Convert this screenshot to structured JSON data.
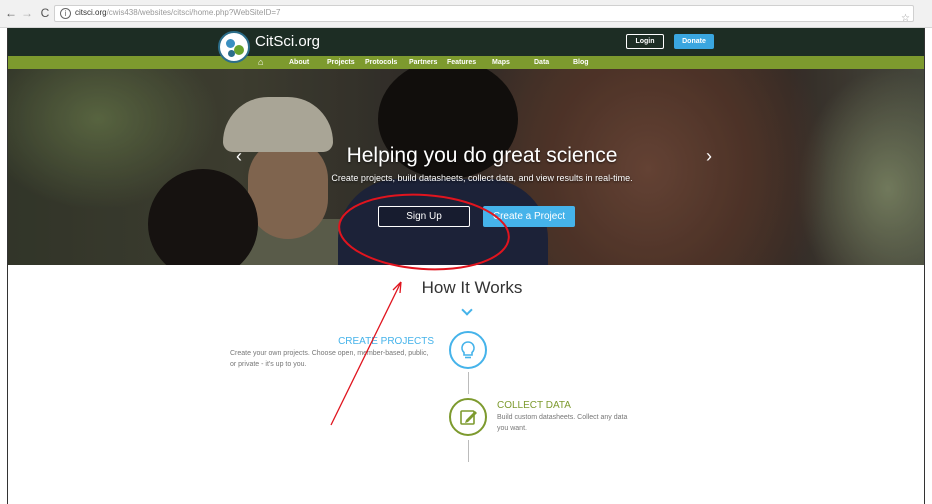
{
  "browser": {
    "back_glyph": "←",
    "forward_glyph": "→",
    "reload_glyph": "C",
    "info_glyph": "i",
    "url_host": "citsci.org",
    "url_path": "/cwis438/websites/citsci/home.php?WebSiteID=7",
    "star_glyph": "☆"
  },
  "header": {
    "logo_text": "CitSci.org",
    "login_label": "Login",
    "donate_label": "Donate"
  },
  "nav": {
    "home_glyph": "⌂",
    "items": [
      "About",
      "Projects",
      "Protocols",
      "Partners",
      "Features",
      "Maps",
      "Data",
      "Blog"
    ]
  },
  "hero": {
    "title": "Helping you do great science",
    "subtitle": "Create projects, build datasheets, collect data, and view results in real-time.",
    "prev_glyph": "‹",
    "next_glyph": "›",
    "signup_label": "Sign Up",
    "create_label": "Create a Project"
  },
  "how_it_works": {
    "title": "How It Works",
    "steps": [
      {
        "title": "CREATE PROJECTS",
        "description": "Create your own projects. Choose open, member-based, public, or private - it's up to you.",
        "icon": "lightbulb-icon"
      },
      {
        "title": "COLLECT DATA",
        "description": "Build custom datasheets. Collect any data you want.",
        "icon": "pencil-icon"
      }
    ]
  },
  "colors": {
    "header_bg": "#1d2d24",
    "nav_green": "#7d9a2e",
    "accent_blue": "#45b3ea",
    "annotation_red": "#e0141e"
  }
}
